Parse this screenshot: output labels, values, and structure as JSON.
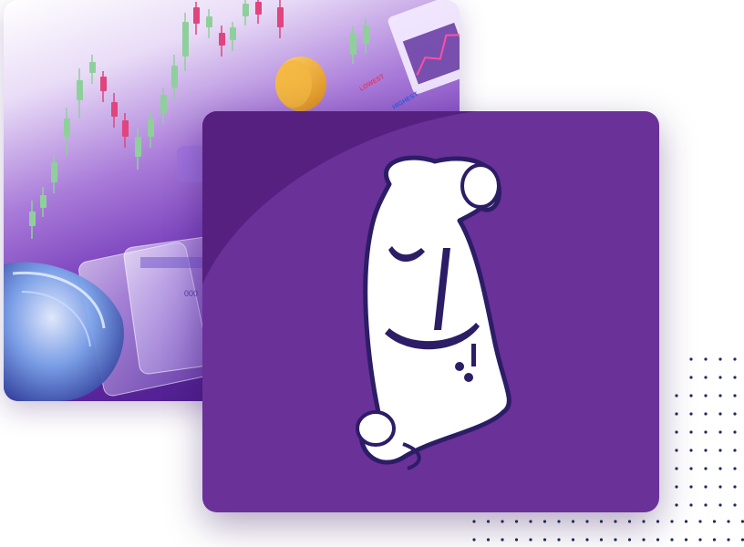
{
  "background_image": {
    "labels": [
      "LOWEST",
      "HIGHEST"
    ],
    "card_number_fragment": "000"
  },
  "logo": {
    "description_icon": "scroll-logo-icon",
    "colors": {
      "panel": "#6a3199",
      "arc": "#552080",
      "scroll": "#ffffff",
      "glyph": "#2c1d66"
    }
  },
  "colors": {
    "dots": "#1e2a5a",
    "candle_green": "#8fcf9c",
    "candle_red": "#e0457e"
  }
}
